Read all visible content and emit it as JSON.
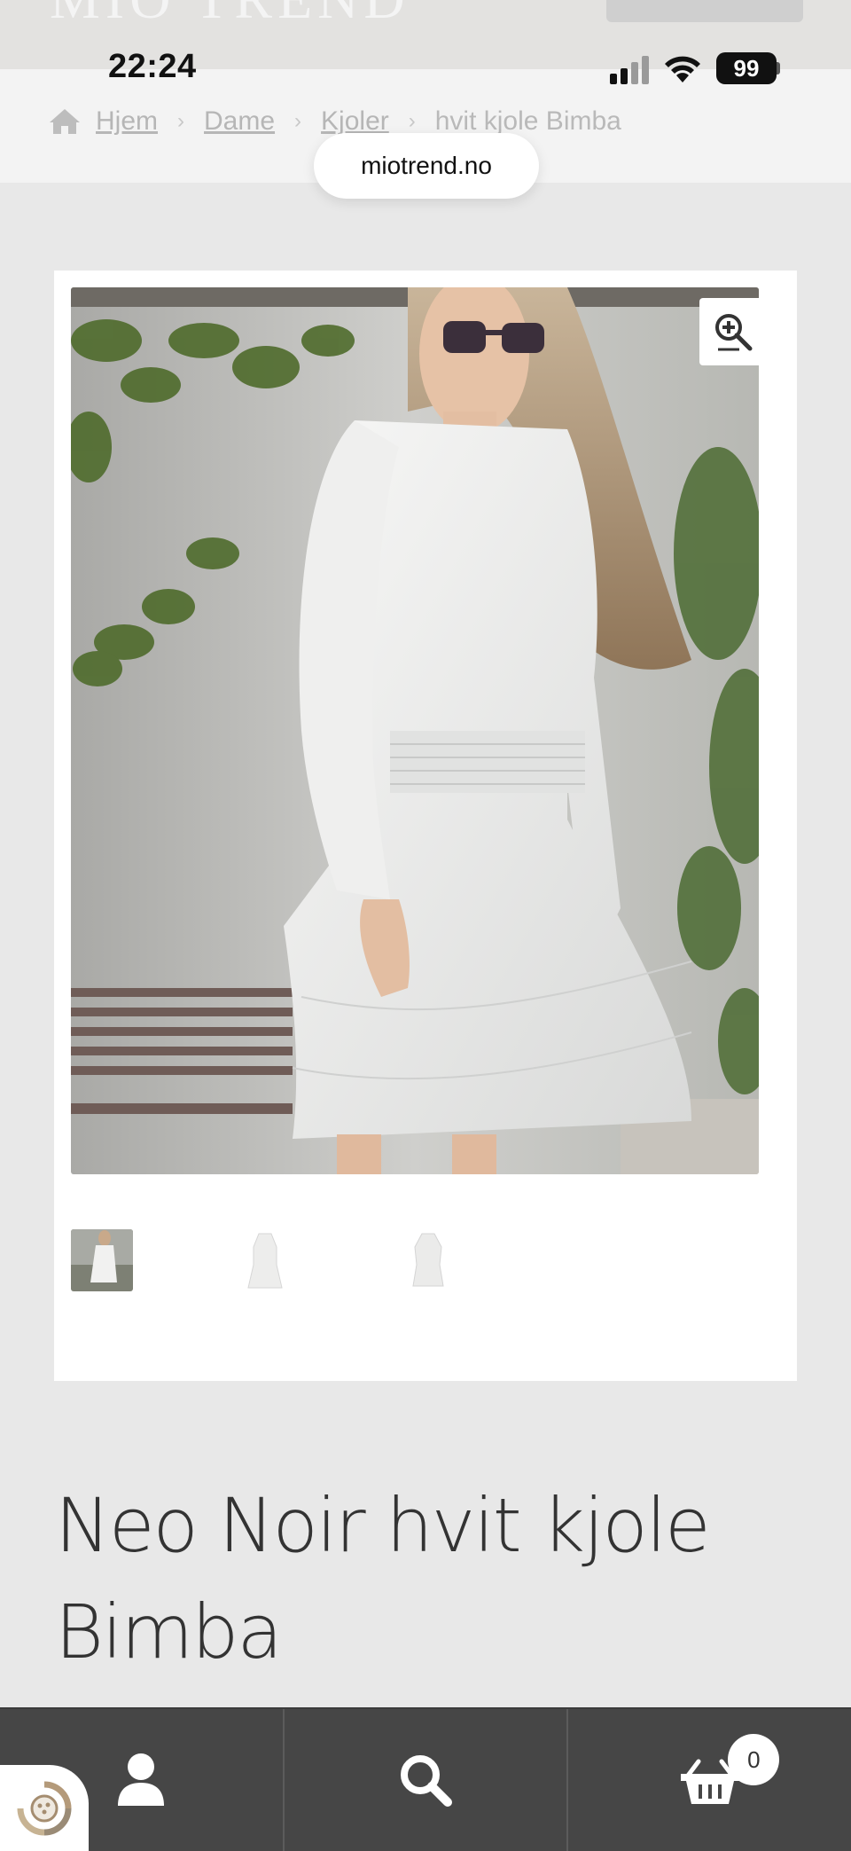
{
  "site": {
    "logo_text": "MIO TREND"
  },
  "status_bar": {
    "time": "22:24",
    "battery": "99"
  },
  "breadcrumb": [
    {
      "label": "Hjem"
    },
    {
      "label": "Dame"
    },
    {
      "label": "Kjoler"
    },
    {
      "label": "hvit kjole Bimba"
    }
  ],
  "browser": {
    "url": "miotrend.no"
  },
  "product": {
    "title": "Neo Noir hvit kjole Bimba",
    "gallery": {
      "thumbnail_count": 3
    }
  },
  "bottom_nav": {
    "items": [
      {
        "icon": "user-icon"
      },
      {
        "icon": "search-icon"
      },
      {
        "icon": "cart-icon",
        "count": "0"
      }
    ]
  },
  "colors": {
    "nav_background": "#464646",
    "page_background": "#e8e8e8"
  }
}
